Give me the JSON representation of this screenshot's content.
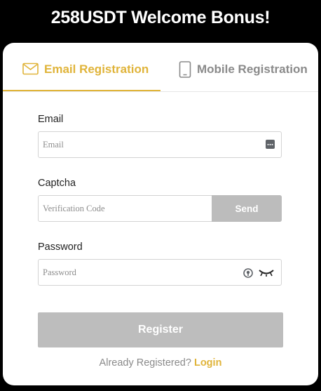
{
  "banner": {
    "title": "258USDT Welcome Bonus!"
  },
  "tabs": {
    "email": "Email Registration",
    "mobile": "Mobile Registration",
    "active": "email"
  },
  "form": {
    "email": {
      "label": "Email",
      "placeholder": "Email",
      "value": ""
    },
    "captcha": {
      "label": "Captcha",
      "placeholder": "Verification Code",
      "value": "",
      "send_label": "Send"
    },
    "password": {
      "label": "Password",
      "placeholder": "Password",
      "value": ""
    },
    "register_label": "Register"
  },
  "footer": {
    "prompt": "Already Registered?",
    "login_label": "Login"
  },
  "icons": {
    "email_tab": "envelope-icon",
    "mobile_tab": "phone-icon",
    "email_field": "password-manager-icon",
    "password_manager": "password-manager-icon",
    "password_toggle": "eye-closed-icon"
  },
  "colors": {
    "accent": "#e0b43a",
    "disabled_button": "#bdbdbd",
    "background": "#000000",
    "card": "#ffffff"
  }
}
